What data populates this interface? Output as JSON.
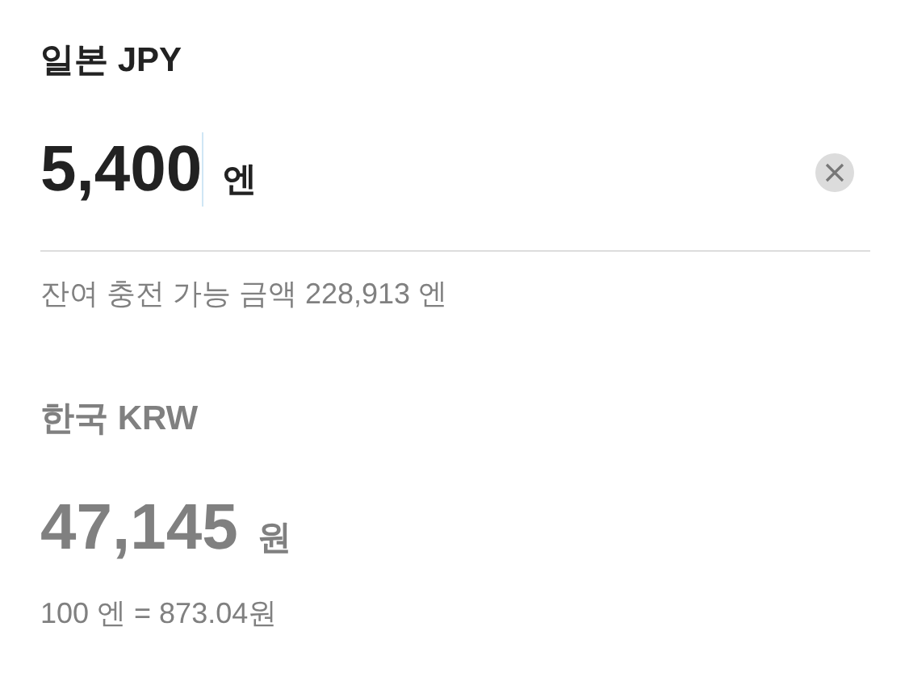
{
  "source": {
    "label": "일본 JPY",
    "amount": "5,400",
    "unit": "엔",
    "note": "잔여 충전 가능 금액 228,913 엔"
  },
  "target": {
    "label": "한국 KRW",
    "amount": "47,145",
    "unit": "원",
    "rate": "100 엔 = 873.04원"
  }
}
